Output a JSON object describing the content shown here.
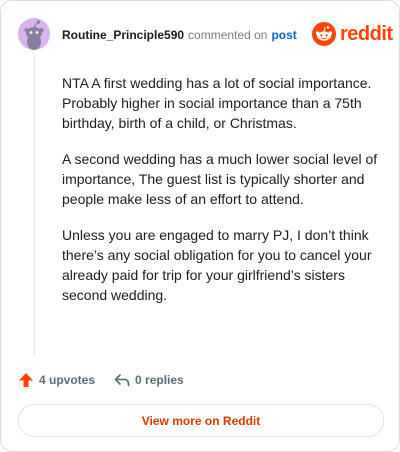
{
  "comment": {
    "username": "Routine_Principle590",
    "action_text": "commented on",
    "post_link": "post",
    "body": [
      "NTA A first wedding has a lot of social importance. Probably higher in social importance than a 75th birthday, birth of a child, or Christmas.",
      "A second wedding has a much lower social level of importance, The guest list is typically shorter and people make less of an effort to attend.",
      "Unless you are engaged to marry PJ, I don’t think there’s any social obligation for you to cancel your already paid for trip for your girlfriend’s sisters second wedding."
    ],
    "upvotes_label": "4 upvotes",
    "replies_label": "0 replies"
  },
  "brand": {
    "logo_text": "reddit",
    "color": "#ff4500"
  },
  "footer": {
    "view_more_label": "View more on Reddit"
  },
  "icons": {
    "avatar": "snoo-avatar-icon",
    "logo": "reddit-logo-icon",
    "upvote": "upvote-arrow-icon",
    "reply": "reply-arrow-icon"
  }
}
